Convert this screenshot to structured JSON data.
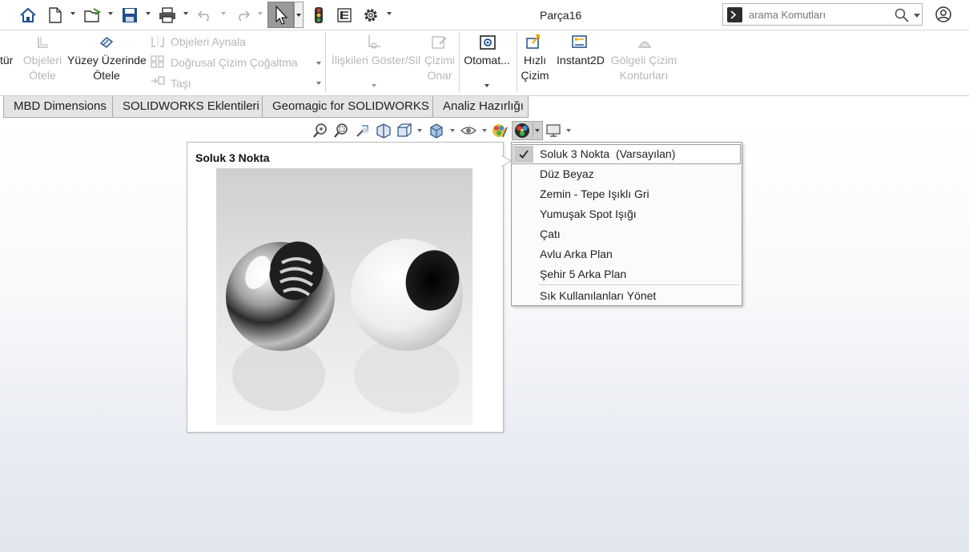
{
  "titlebar": {
    "document_title": "Parça16",
    "search_placeholder": "arama Komutları"
  },
  "ribbon": {
    "partial_label": "tür",
    "objeleri_otele": [
      "Objeleri",
      "Ötele"
    ],
    "yuzey_uzerinde_otele": [
      "Yüzey Üzerinde",
      "Ötele"
    ],
    "objeleri_aynala": "Objeleri Aynala",
    "dogrusal_cizim_cogaltma": "Doğrusal Çizim Çoğaltma",
    "tasi": "Taşı",
    "iliskileri_goster_sil": "İlişkileri Göster/Sil",
    "cizimi_onar": [
      "Çizimi",
      "Onar"
    ],
    "otomatik": "Otomat...",
    "hizli_cizim": [
      "Hızlı",
      "Çizim"
    ],
    "instant2d": "Instant2D",
    "golgeli_cizim_konturlari": [
      "Gölgeli Çizim",
      "Konturları"
    ]
  },
  "tabs": [
    {
      "label": "MBD Dimensions"
    },
    {
      "label": "SOLIDWORKS Eklentileri"
    },
    {
      "label": "Geomagic for SOLIDWORKS"
    },
    {
      "label": "Analiz Hazırlığı"
    }
  ],
  "preview": {
    "title": "Soluk 3 Nokta"
  },
  "scene_menu": {
    "items": [
      {
        "label": "Soluk 3 Nokta  (Varsayılan)",
        "checked": true
      },
      {
        "label": "Düz Beyaz"
      },
      {
        "label": "Zemin - Tepe Işıklı Gri"
      },
      {
        "label": "Yumuşak Spot Işığı"
      },
      {
        "label": "Çatı"
      },
      {
        "label": "Avlu Arka Plan"
      },
      {
        "label": "Şehir 5 Arka Plan"
      }
    ],
    "manage_favorites": "Sık Kullanılanları Yönet"
  }
}
